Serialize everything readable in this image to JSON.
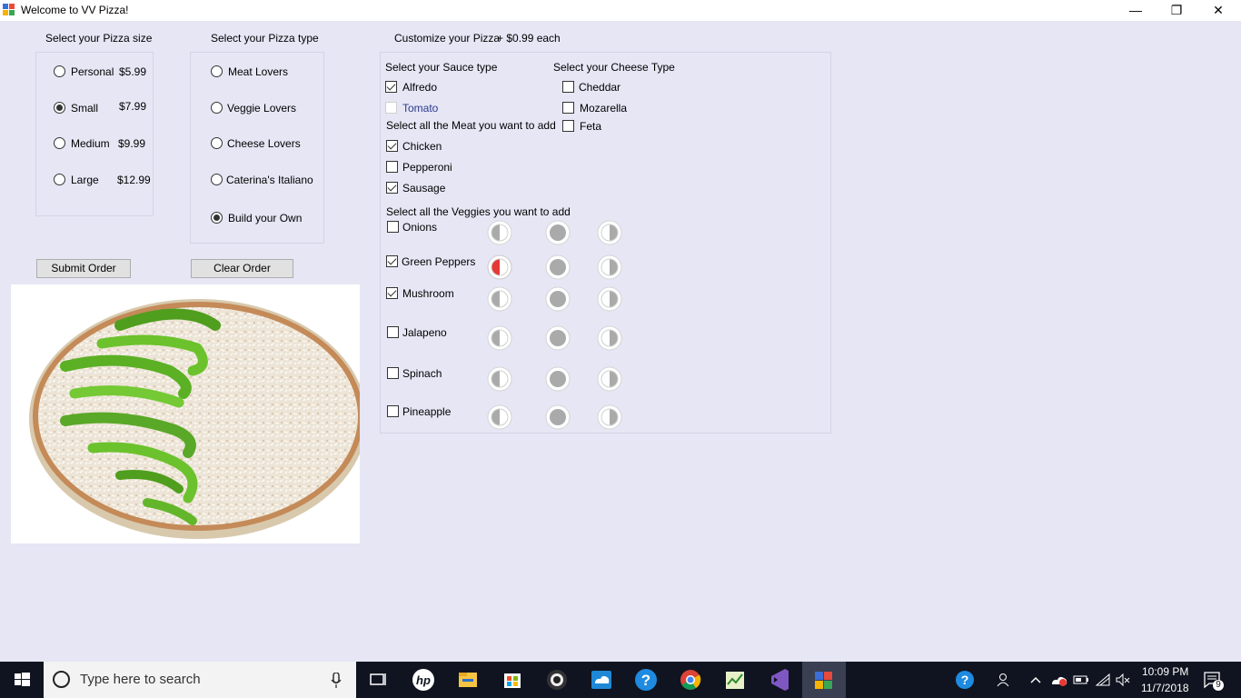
{
  "window": {
    "title": "Welcome to VV Pizza!",
    "minimize": "—",
    "restore": "❐",
    "close": "✕"
  },
  "size_group": {
    "heading": "Select your Pizza size",
    "options": [
      {
        "label": "Personal",
        "price": "$5.99",
        "checked": false
      },
      {
        "label": "Small",
        "price": "$7.99",
        "checked": true
      },
      {
        "label": "Medium",
        "price": "$9.99",
        "checked": false
      },
      {
        "label": "Large",
        "price": "$12.99",
        "checked": false
      }
    ]
  },
  "type_group": {
    "heading": "Select your Pizza type",
    "options": [
      {
        "label": "Meat Lovers",
        "checked": false
      },
      {
        "label": "Veggie Lovers",
        "checked": false
      },
      {
        "label": "Cheese Lovers",
        "checked": false
      },
      {
        "label": "Caterina's Italiano",
        "checked": false
      },
      {
        "label": "Build your Own",
        "checked": true
      }
    ]
  },
  "customize": {
    "heading": "Customize your Pizza",
    "price_note": "+ $0.99 each",
    "sauce_heading": "Select your Sauce type",
    "sauces": [
      {
        "label": "Alfredo",
        "checked": true,
        "enabled": true
      },
      {
        "label": "Tomato",
        "checked": false,
        "enabled": false
      }
    ],
    "cheese_heading": "Select your Cheese Type",
    "cheeses": [
      {
        "label": "Cheddar",
        "checked": false
      },
      {
        "label": "Mozarella",
        "checked": false
      },
      {
        "label": "Feta",
        "checked": false
      }
    ],
    "meat_heading": "Select all the Meat you want to add",
    "meats": [
      {
        "label": "Chicken",
        "checked": true
      },
      {
        "label": "Pepperoni",
        "checked": false
      },
      {
        "label": "Sausage",
        "checked": true
      }
    ],
    "veggie_heading": "Select all the Veggies you want to add",
    "veggies": [
      {
        "label": "Onions",
        "checked": false,
        "selected_coverage": "none"
      },
      {
        "label": "Green Peppers",
        "checked": true,
        "selected_coverage": "left-half"
      },
      {
        "label": "Mushroom",
        "checked": true,
        "selected_coverage": "none"
      },
      {
        "label": "Jalapeno",
        "checked": false,
        "selected_coverage": "none"
      },
      {
        "label": "Spinach",
        "checked": false,
        "selected_coverage": "none"
      },
      {
        "label": "Pineapple",
        "checked": false,
        "selected_coverage": "none"
      }
    ],
    "coverage_options": [
      "left-half",
      "whole",
      "right-half"
    ]
  },
  "buttons": {
    "submit": "Submit Order",
    "clear": "Clear Order"
  },
  "colors": {
    "window_bg": "#e6e6f5",
    "selected_coverage": "#e53935",
    "coverage_fill": "#aaaaaa",
    "taskbar": "#101420"
  },
  "taskbar": {
    "search_placeholder": "Type here to search",
    "time": "10:09 PM",
    "date": "11/7/2018",
    "notification_count": "9"
  }
}
